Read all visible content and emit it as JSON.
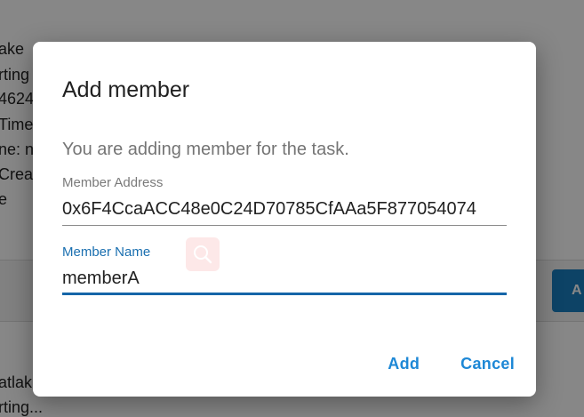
{
  "background": {
    "lines": [
      {
        "text": "ake"
      },
      {
        "text": "rting"
      },
      {
        "text": "4624"
      },
      {
        "text": "Time"
      },
      {
        "text": "ne: n"
      },
      {
        "text": "Creat"
      },
      {
        "text": "e"
      }
    ],
    "lower_lines": [
      {
        "text": "atlak"
      },
      {
        "text": "rting..."
      }
    ],
    "button_label": "A"
  },
  "dialog": {
    "title": "Add member",
    "description": "You are adding member for the task.",
    "address": {
      "label": "Member Address",
      "value": "0x6F4CcaACC48e0C24D70785CfAAa5F877054074"
    },
    "name": {
      "label": "Member Name",
      "value": "memberA"
    },
    "search_icon": "search-icon",
    "actions": {
      "add_label": "Add",
      "cancel_label": "Cancel"
    }
  },
  "colors": {
    "accent": "#1e88d6",
    "focused_underline": "#1565a8",
    "scrim": "rgba(0,0,0,0.47)"
  }
}
